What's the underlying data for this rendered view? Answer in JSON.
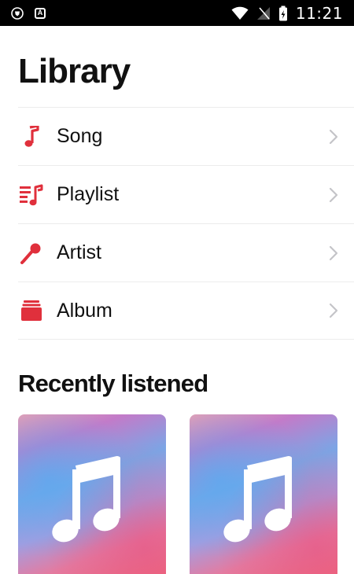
{
  "status_bar": {
    "time": "11:21",
    "left_icons": [
      "shield-icon",
      "a-badge-icon"
    ],
    "right_icons": [
      "wifi-icon",
      "no-signal-icon",
      "battery-charging-icon"
    ]
  },
  "page": {
    "title": "Library"
  },
  "menu": {
    "items": [
      {
        "label": "Song",
        "icon": "music-note-icon"
      },
      {
        "label": "Playlist",
        "icon": "playlist-icon"
      },
      {
        "label": "Artist",
        "icon": "microphone-icon"
      },
      {
        "label": "Album",
        "icon": "album-stack-icon"
      }
    ]
  },
  "recent": {
    "title": "Recently listened",
    "cards": [
      {
        "art": "music-note-icon"
      },
      {
        "art": "music-note-icon"
      }
    ]
  },
  "colors": {
    "accent": "#e0303c",
    "chevron": "#c4c4c8",
    "divider": "#ececec"
  }
}
